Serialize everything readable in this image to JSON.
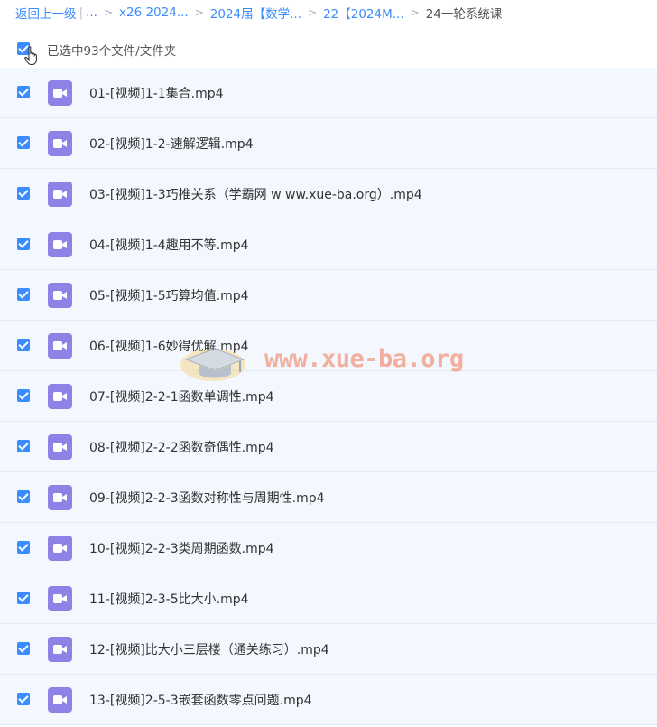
{
  "breadcrumb": {
    "back": "返回上一级",
    "ellipsis": "...",
    "items": [
      "x26 2024...",
      "2024届【数学...",
      "22【2024M..."
    ],
    "current": "24一轮系统课"
  },
  "selection": {
    "label": "已选中93个文件/文件夹",
    "all_checked": true
  },
  "files": [
    {
      "name": "01-[视频]1-1集合.mp4"
    },
    {
      "name": "02-[视频]1-2-速解逻辑.mp4"
    },
    {
      "name": "03-[视频]1-3巧推关系（学霸网 w ww.xue-ba.org）.mp4"
    },
    {
      "name": "04-[视频]1-4趣用不等.mp4"
    },
    {
      "name": "05-[视频]1-5巧算均值.mp4"
    },
    {
      "name": "06-[视频]1-6妙得优解.mp4"
    },
    {
      "name": "07-[视频]2-2-1函数单调性.mp4"
    },
    {
      "name": "08-[视频]2-2-2函数奇偶性.mp4"
    },
    {
      "name": "09-[视频]2-2-3函数对称性与周期性.mp4"
    },
    {
      "name": "10-[视频]2-2-3类周期函数.mp4"
    },
    {
      "name": "11-[视频]2-3-5比大小.mp4"
    },
    {
      "name": "12-[视频]比大小三层楼（通关练习）.mp4"
    },
    {
      "name": "13-[视频]2-5-3嵌套函数零点问题.mp4"
    }
  ],
  "icons": {
    "file": "video-file-icon",
    "cursor": "hand-cursor-icon"
  },
  "watermark": {
    "text": "www.xue-ba.org"
  },
  "colors": {
    "accent": "#3b8cff",
    "file_icon": "#8e82e6",
    "row_bg": "#f3f8ff",
    "watermark": "#f2a38d"
  }
}
